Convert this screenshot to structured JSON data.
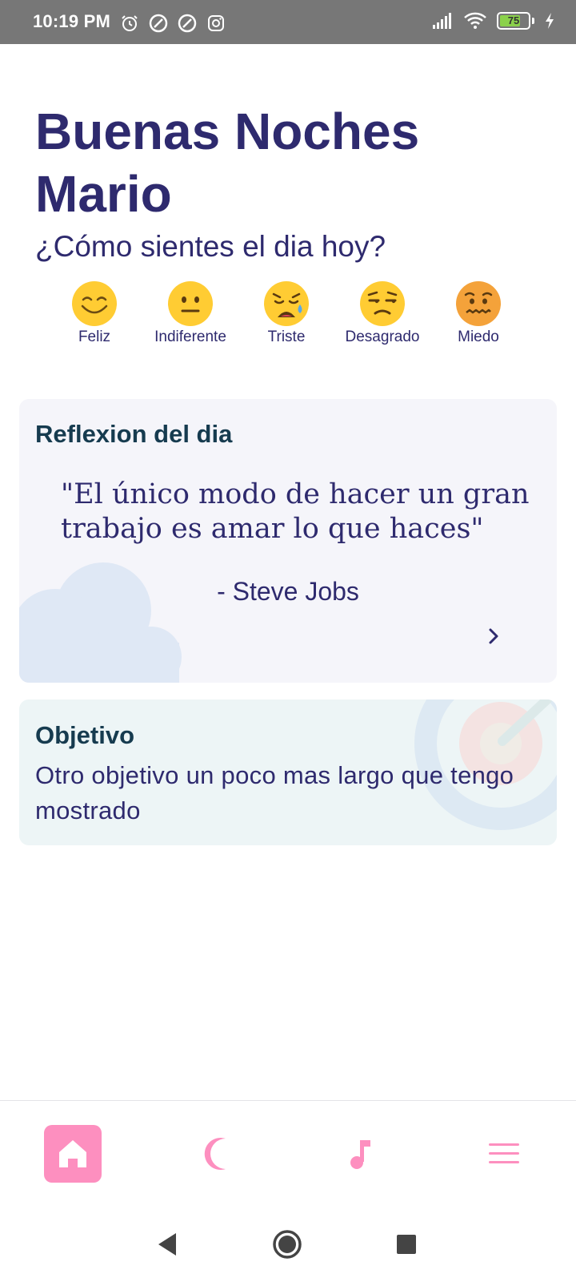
{
  "status_bar": {
    "time": "10:19 PM",
    "battery_level": "75",
    "battery_fraction": 0.75,
    "left_icons": [
      "alarm-icon",
      "app-icon",
      "app-icon",
      "instagram-icon"
    ],
    "right_icons": [
      "signal-icon",
      "wifi-icon",
      "battery-icon",
      "charging-icon"
    ]
  },
  "header": {
    "greeting": "Buenas Noches Mario",
    "question": "¿Cómo sientes el dia hoy?"
  },
  "moods": [
    {
      "label": "Feliz",
      "icon": "smiling-face-icon"
    },
    {
      "label": "Indiferente",
      "icon": "neutral-face-icon"
    },
    {
      "label": "Triste",
      "icon": "crying-face-icon"
    },
    {
      "label": "Desagrado",
      "icon": "unamused-face-icon"
    },
    {
      "label": "Miedo",
      "icon": "fearful-face-icon"
    }
  ],
  "reflection": {
    "title": "Reflexion del dia",
    "quote": "\"El único modo de hacer un gran trabajo es amar lo que haces\"",
    "author": "- Steve Jobs",
    "arrow_icon": "chevron-right-icon"
  },
  "objective": {
    "title": "Objetivo",
    "text": "Otro objetivo un poco mas largo que tengo mostrado"
  },
  "bottom_nav": {
    "items": [
      {
        "name": "home",
        "icon": "home-icon",
        "active": true
      },
      {
        "name": "sleep",
        "icon": "moon-icon",
        "active": false
      },
      {
        "name": "music",
        "icon": "music-note-icon",
        "active": false
      },
      {
        "name": "menu",
        "icon": "menu-icon",
        "active": false
      }
    ]
  },
  "colors": {
    "primary_text": "#2e2a6e",
    "title_text": "#163b4f",
    "accent_pink": "#fd8fbf",
    "reflection_bg": "#f5f5fa",
    "objective_bg": "#edf5f6",
    "status_bar_bg": "#777777"
  }
}
